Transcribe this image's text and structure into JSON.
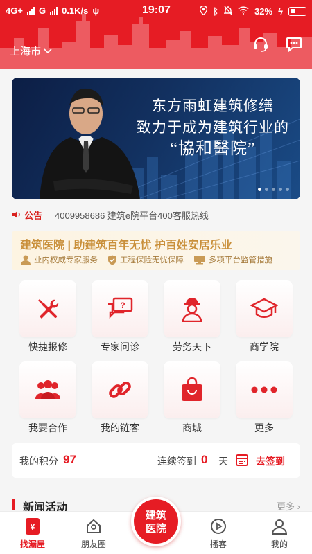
{
  "status_bar": {
    "network": "4G+",
    "carrier2": "G",
    "speed": "0.1K/s",
    "time": "19:07",
    "battery": "32%"
  },
  "header": {
    "city": "上海市",
    "icons": [
      "customer-service-icon",
      "message-icon"
    ]
  },
  "banner": {
    "slogan_line1": "东方雨虹建筑修缮",
    "slogan_line2": "致力于成为建筑行业的",
    "slogan_line3": "“協和醫院”",
    "slide_count": 5,
    "active_slide": 1
  },
  "notice": {
    "tag": "公告",
    "message": "4009958686 建筑e院平台400客服热线"
  },
  "promo": {
    "title": "建筑医院 | 助建筑百年无忧 护百姓安居乐业",
    "features": [
      {
        "label": "业内权威专家服务",
        "icon": "expert-icon"
      },
      {
        "label": "工程保险无忧保障",
        "icon": "shield-check-icon"
      },
      {
        "label": "多项平台监管措施",
        "icon": "monitor-icon"
      }
    ]
  },
  "grid": [
    {
      "label": "快捷报修",
      "icon": "tools-icon"
    },
    {
      "label": "专家问诊",
      "icon": "consult-icon"
    },
    {
      "label": "劳务天下",
      "icon": "worker-icon"
    },
    {
      "label": "商学院",
      "icon": "graduation-cap-icon"
    },
    {
      "label": "我要合作",
      "icon": "group-icon"
    },
    {
      "label": "我的链客",
      "icon": "link-icon"
    },
    {
      "label": "商城",
      "icon": "shopping-bag-icon"
    },
    {
      "label": "更多",
      "icon": "more-icon"
    }
  ],
  "points": {
    "label": "我的积分",
    "value": "97",
    "streak_label": "连续签到",
    "streak_days": "0",
    "streak_unit": "天",
    "sign_button": "去签到"
  },
  "news": {
    "title": "新闻活动",
    "more": "更多 ›"
  },
  "bottom_nav": {
    "items": [
      {
        "label": "找漏屋",
        "icon": "home-red-icon",
        "active": true
      },
      {
        "label": "朋友圈",
        "icon": "friends-icon",
        "active": false
      },
      {
        "label": "播客",
        "icon": "play-icon",
        "active": false
      },
      {
        "label": "我的",
        "icon": "user-icon",
        "active": false
      }
    ],
    "center_line1": "建筑",
    "center_line2": "医院"
  },
  "colors": {
    "brand_red": "#e61c24",
    "gold": "#c98f3a"
  }
}
